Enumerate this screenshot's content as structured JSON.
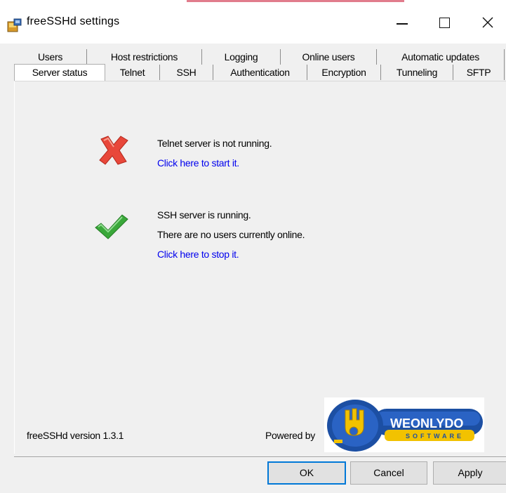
{
  "window": {
    "title": "freeSSHd settings",
    "icon": "freesshd-app-icon",
    "controls": [
      "minimize-icon",
      "maximize-icon",
      "close-icon"
    ]
  },
  "tabs": {
    "row1": [
      "Users",
      "Host restrictions",
      "Logging",
      "Online users",
      "Automatic updates"
    ],
    "row2": [
      "Server status",
      "Telnet",
      "SSH",
      "Authentication",
      "Encryption",
      "Tunneling",
      "SFTP"
    ],
    "active": "Server status"
  },
  "status": {
    "telnet": {
      "icon": "red-x-icon",
      "message": "Telnet server is not running.",
      "action": "Click here to start it."
    },
    "ssh": {
      "icon": "green-check-icon",
      "message": "SSH server is running.",
      "users": "There are no users currently online.",
      "action": "Click here to stop it."
    }
  },
  "footer": {
    "version": "freeSSHd version 1.3.1",
    "powered_by": "Powered by",
    "logo_text": "WEONLYDO",
    "logo_subtext": "SOFTWARE"
  },
  "buttons": {
    "ok": "OK",
    "cancel": "Cancel",
    "apply": "Apply"
  },
  "colors": {
    "link": "#0000ee",
    "logo_blue": "#1c4fa3",
    "logo_yellow": "#f2c200",
    "error_red": "#e8473a",
    "ok_green": "#3aa83a"
  }
}
